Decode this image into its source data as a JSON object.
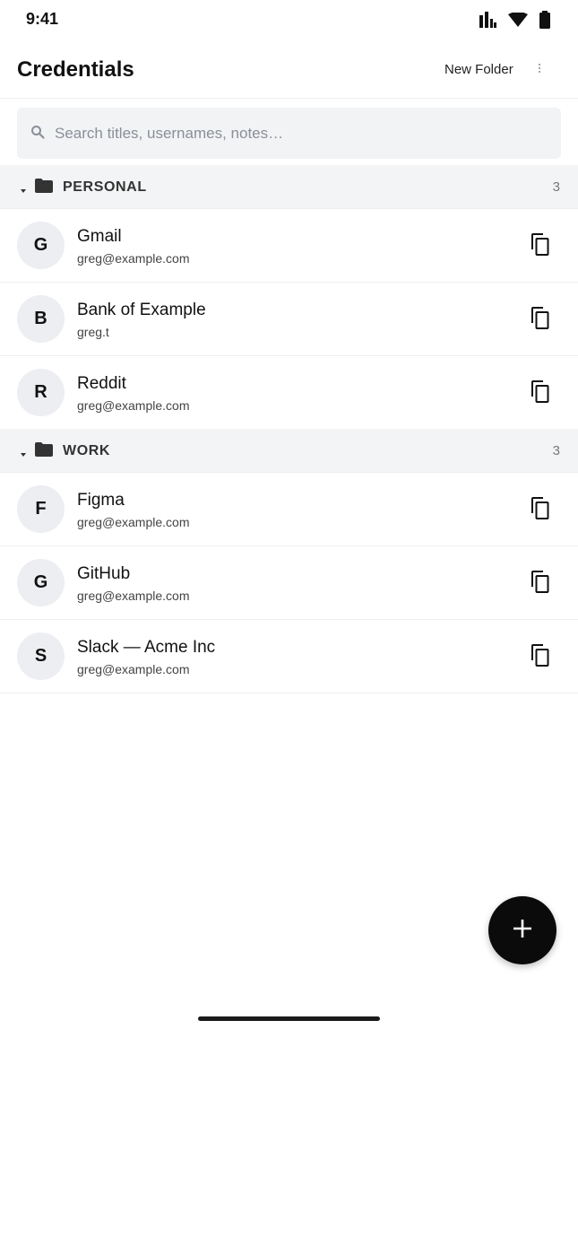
{
  "status_bar": {
    "time": "9:41",
    "icons": [
      "signal-icon",
      "wifi-icon",
      "battery-icon"
    ]
  },
  "app_bar": {
    "title": "Credentials",
    "new_folder_label": "New Folder",
    "more_icon": "more-vertical-icon"
  },
  "search": {
    "placeholder": "Search titles, usernames, notes…",
    "value": ""
  },
  "folders": [
    {
      "name": "PERSONAL",
      "count": "3",
      "items": [
        {
          "initial": "G",
          "title": "Gmail",
          "username": "greg@example.com"
        },
        {
          "initial": "B",
          "title": "Bank of Example",
          "username": "greg.t"
        },
        {
          "initial": "R",
          "title": "Reddit",
          "username": "greg@example.com"
        }
      ]
    },
    {
      "name": "WORK",
      "count": "3",
      "items": [
        {
          "initial": "F",
          "title": "Figma",
          "username": "greg@example.com"
        },
        {
          "initial": "G",
          "title": "GitHub",
          "username": "greg@example.com"
        },
        {
          "initial": "S",
          "title": "Slack — Acme Inc",
          "username": "greg@example.com"
        }
      ]
    }
  ],
  "fab": {
    "icon": "plus-icon"
  },
  "colors": {
    "fab": "#0b0b0b",
    "folder_header_bg": "#f3f4f6",
    "search_bg": "#f2f3f5",
    "avatar_bg": "#eceef1"
  }
}
